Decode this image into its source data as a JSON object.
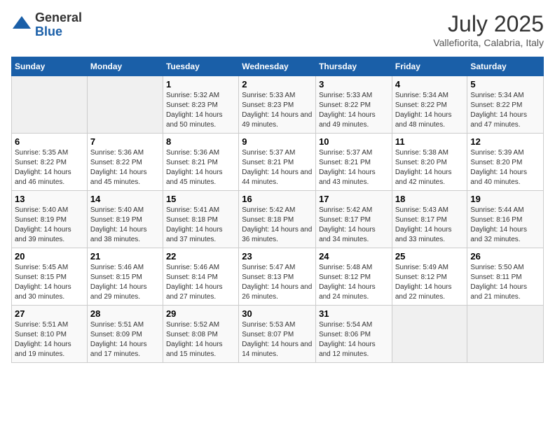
{
  "logo": {
    "general": "General",
    "blue": "Blue"
  },
  "header": {
    "month_year": "July 2025",
    "location": "Vallefiorita, Calabria, Italy"
  },
  "days_of_week": [
    "Sunday",
    "Monday",
    "Tuesday",
    "Wednesday",
    "Thursday",
    "Friday",
    "Saturday"
  ],
  "weeks": [
    [
      {
        "day": "",
        "sunrise": "",
        "sunset": "",
        "daylight": "",
        "empty": true
      },
      {
        "day": "",
        "sunrise": "",
        "sunset": "",
        "daylight": "",
        "empty": true
      },
      {
        "day": "1",
        "sunrise": "Sunrise: 5:32 AM",
        "sunset": "Sunset: 8:23 PM",
        "daylight": "Daylight: 14 hours and 50 minutes."
      },
      {
        "day": "2",
        "sunrise": "Sunrise: 5:33 AM",
        "sunset": "Sunset: 8:23 PM",
        "daylight": "Daylight: 14 hours and 49 minutes."
      },
      {
        "day": "3",
        "sunrise": "Sunrise: 5:33 AM",
        "sunset": "Sunset: 8:22 PM",
        "daylight": "Daylight: 14 hours and 49 minutes."
      },
      {
        "day": "4",
        "sunrise": "Sunrise: 5:34 AM",
        "sunset": "Sunset: 8:22 PM",
        "daylight": "Daylight: 14 hours and 48 minutes."
      },
      {
        "day": "5",
        "sunrise": "Sunrise: 5:34 AM",
        "sunset": "Sunset: 8:22 PM",
        "daylight": "Daylight: 14 hours and 47 minutes."
      }
    ],
    [
      {
        "day": "6",
        "sunrise": "Sunrise: 5:35 AM",
        "sunset": "Sunset: 8:22 PM",
        "daylight": "Daylight: 14 hours and 46 minutes."
      },
      {
        "day": "7",
        "sunrise": "Sunrise: 5:36 AM",
        "sunset": "Sunset: 8:22 PM",
        "daylight": "Daylight: 14 hours and 45 minutes."
      },
      {
        "day": "8",
        "sunrise": "Sunrise: 5:36 AM",
        "sunset": "Sunset: 8:21 PM",
        "daylight": "Daylight: 14 hours and 45 minutes."
      },
      {
        "day": "9",
        "sunrise": "Sunrise: 5:37 AM",
        "sunset": "Sunset: 8:21 PM",
        "daylight": "Daylight: 14 hours and 44 minutes."
      },
      {
        "day": "10",
        "sunrise": "Sunrise: 5:37 AM",
        "sunset": "Sunset: 8:21 PM",
        "daylight": "Daylight: 14 hours and 43 minutes."
      },
      {
        "day": "11",
        "sunrise": "Sunrise: 5:38 AM",
        "sunset": "Sunset: 8:20 PM",
        "daylight": "Daylight: 14 hours and 42 minutes."
      },
      {
        "day": "12",
        "sunrise": "Sunrise: 5:39 AM",
        "sunset": "Sunset: 8:20 PM",
        "daylight": "Daylight: 14 hours and 40 minutes."
      }
    ],
    [
      {
        "day": "13",
        "sunrise": "Sunrise: 5:40 AM",
        "sunset": "Sunset: 8:19 PM",
        "daylight": "Daylight: 14 hours and 39 minutes."
      },
      {
        "day": "14",
        "sunrise": "Sunrise: 5:40 AM",
        "sunset": "Sunset: 8:19 PM",
        "daylight": "Daylight: 14 hours and 38 minutes."
      },
      {
        "day": "15",
        "sunrise": "Sunrise: 5:41 AM",
        "sunset": "Sunset: 8:18 PM",
        "daylight": "Daylight: 14 hours and 37 minutes."
      },
      {
        "day": "16",
        "sunrise": "Sunrise: 5:42 AM",
        "sunset": "Sunset: 8:18 PM",
        "daylight": "Daylight: 14 hours and 36 minutes."
      },
      {
        "day": "17",
        "sunrise": "Sunrise: 5:42 AM",
        "sunset": "Sunset: 8:17 PM",
        "daylight": "Daylight: 14 hours and 34 minutes."
      },
      {
        "day": "18",
        "sunrise": "Sunrise: 5:43 AM",
        "sunset": "Sunset: 8:17 PM",
        "daylight": "Daylight: 14 hours and 33 minutes."
      },
      {
        "day": "19",
        "sunrise": "Sunrise: 5:44 AM",
        "sunset": "Sunset: 8:16 PM",
        "daylight": "Daylight: 14 hours and 32 minutes."
      }
    ],
    [
      {
        "day": "20",
        "sunrise": "Sunrise: 5:45 AM",
        "sunset": "Sunset: 8:15 PM",
        "daylight": "Daylight: 14 hours and 30 minutes."
      },
      {
        "day": "21",
        "sunrise": "Sunrise: 5:46 AM",
        "sunset": "Sunset: 8:15 PM",
        "daylight": "Daylight: 14 hours and 29 minutes."
      },
      {
        "day": "22",
        "sunrise": "Sunrise: 5:46 AM",
        "sunset": "Sunset: 8:14 PM",
        "daylight": "Daylight: 14 hours and 27 minutes."
      },
      {
        "day": "23",
        "sunrise": "Sunrise: 5:47 AM",
        "sunset": "Sunset: 8:13 PM",
        "daylight": "Daylight: 14 hours and 26 minutes."
      },
      {
        "day": "24",
        "sunrise": "Sunrise: 5:48 AM",
        "sunset": "Sunset: 8:12 PM",
        "daylight": "Daylight: 14 hours and 24 minutes."
      },
      {
        "day": "25",
        "sunrise": "Sunrise: 5:49 AM",
        "sunset": "Sunset: 8:12 PM",
        "daylight": "Daylight: 14 hours and 22 minutes."
      },
      {
        "day": "26",
        "sunrise": "Sunrise: 5:50 AM",
        "sunset": "Sunset: 8:11 PM",
        "daylight": "Daylight: 14 hours and 21 minutes."
      }
    ],
    [
      {
        "day": "27",
        "sunrise": "Sunrise: 5:51 AM",
        "sunset": "Sunset: 8:10 PM",
        "daylight": "Daylight: 14 hours and 19 minutes."
      },
      {
        "day": "28",
        "sunrise": "Sunrise: 5:51 AM",
        "sunset": "Sunset: 8:09 PM",
        "daylight": "Daylight: 14 hours and 17 minutes."
      },
      {
        "day": "29",
        "sunrise": "Sunrise: 5:52 AM",
        "sunset": "Sunset: 8:08 PM",
        "daylight": "Daylight: 14 hours and 15 minutes."
      },
      {
        "day": "30",
        "sunrise": "Sunrise: 5:53 AM",
        "sunset": "Sunset: 8:07 PM",
        "daylight": "Daylight: 14 hours and 14 minutes."
      },
      {
        "day": "31",
        "sunrise": "Sunrise: 5:54 AM",
        "sunset": "Sunset: 8:06 PM",
        "daylight": "Daylight: 14 hours and 12 minutes."
      },
      {
        "day": "",
        "sunrise": "",
        "sunset": "",
        "daylight": "",
        "empty": true
      },
      {
        "day": "",
        "sunrise": "",
        "sunset": "",
        "daylight": "",
        "empty": true
      }
    ]
  ]
}
